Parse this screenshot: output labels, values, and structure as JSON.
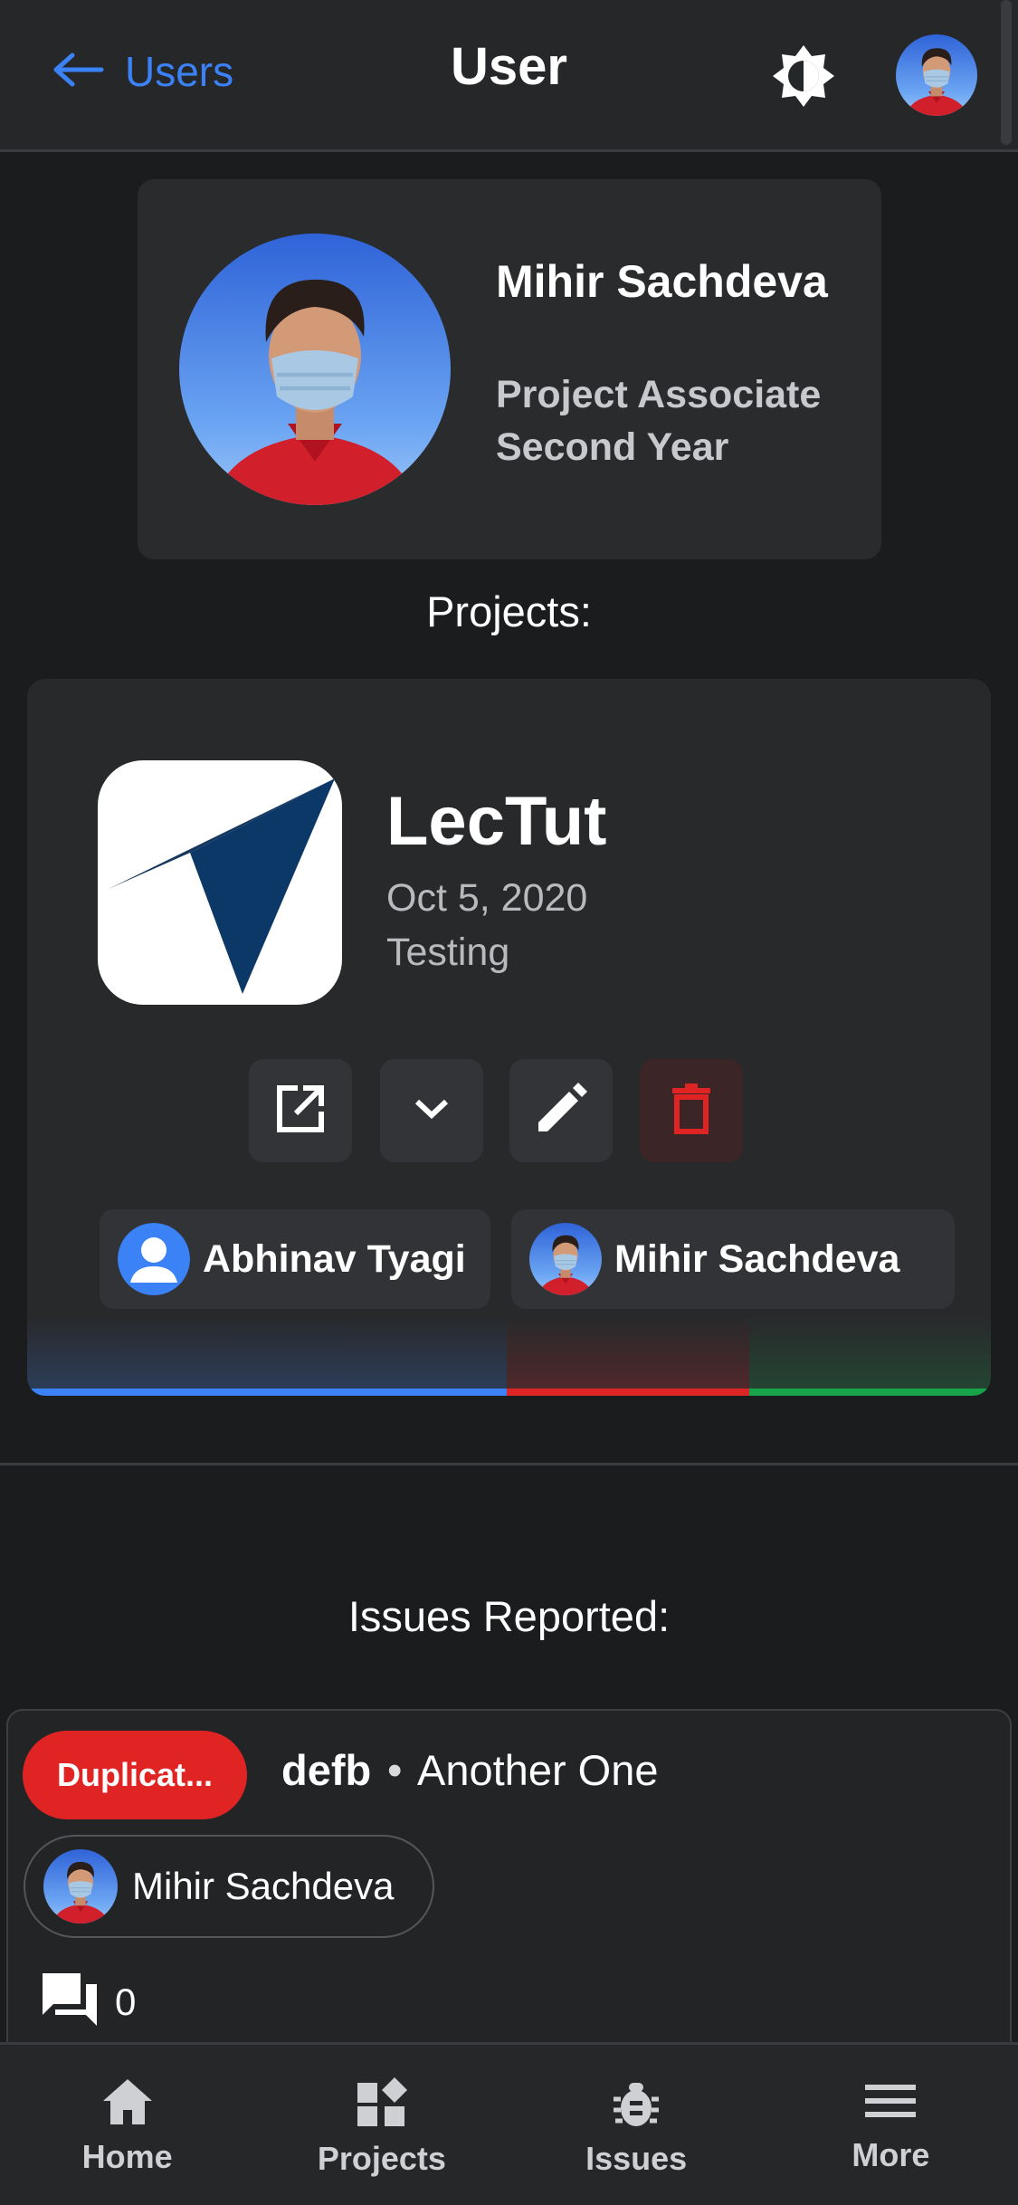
{
  "header": {
    "back_label": "Users",
    "title": "User",
    "theme_icon": "brightness-icon"
  },
  "profile": {
    "name": "Mihir Sachdeva",
    "role": "Project Associate",
    "year": "Second Year"
  },
  "projects_heading": "Projects:",
  "project": {
    "name": "LecTut",
    "date": "Oct 5, 2020",
    "status": "Testing",
    "actions": [
      "open-external-icon",
      "chevron-down-icon",
      "edit-icon",
      "delete-icon"
    ],
    "members": [
      {
        "name": "Abhinav Tyagi",
        "avatar": "default-user-icon"
      },
      {
        "name": "Mihir Sachdeva",
        "avatar": "photo"
      }
    ],
    "status_colors": [
      "#3b82f6",
      "#dc2626",
      "#16a34a"
    ]
  },
  "issues_heading": "Issues Reported:",
  "issue": {
    "badge": "Duplicat...",
    "title": "defb",
    "separator": "•",
    "subtitle": "Another One",
    "reporter": "Mihir Sachdeva",
    "comments": "0"
  },
  "nav": {
    "items": [
      {
        "label": "Home",
        "icon": "home-icon"
      },
      {
        "label": "Projects",
        "icon": "projects-icon"
      },
      {
        "label": "Issues",
        "icon": "bug-icon"
      },
      {
        "label": "More",
        "icon": "menu-icon"
      }
    ]
  },
  "colors": {
    "accent": "#3b82f6",
    "danger": "#e02424",
    "background": "#1b1c1e",
    "card": "#2a2b2d"
  }
}
